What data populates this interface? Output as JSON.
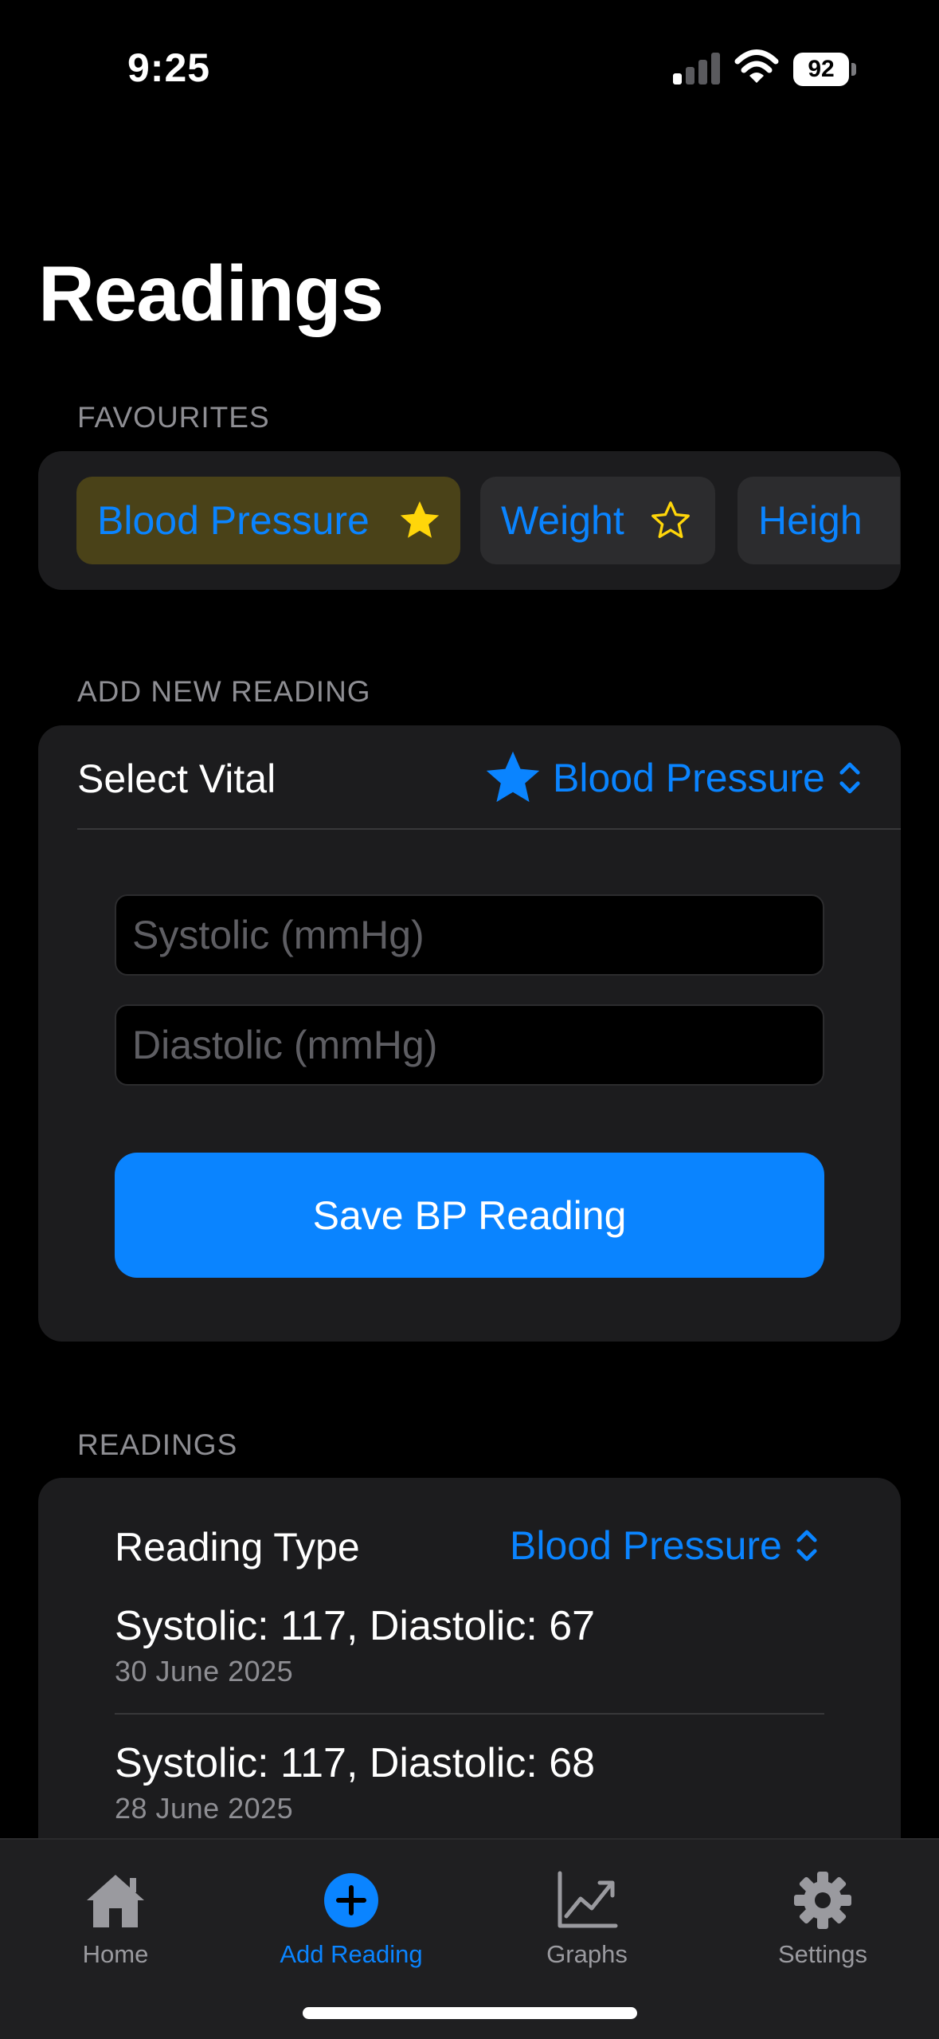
{
  "status_bar": {
    "time": "9:25",
    "battery": "92"
  },
  "page": {
    "title": "Readings"
  },
  "favourites": {
    "header": "FAVOURITES",
    "chips": [
      {
        "label": "Blood Pressure",
        "favourite": true
      },
      {
        "label": "Weight",
        "favourite": false
      },
      {
        "label": "Heigh",
        "favourite": false
      }
    ]
  },
  "add_reading": {
    "header": "ADD NEW READING",
    "select_label": "Select Vital",
    "selected_vital": "Blood Pressure",
    "systolic_placeholder": "Systolic (mmHg)",
    "diastolic_placeholder": "Diastolic (mmHg)",
    "save_label": "Save BP Reading"
  },
  "readings": {
    "header": "READINGS",
    "type_label": "Reading Type",
    "type_value": "Blood Pressure",
    "items": [
      {
        "value": "Systolic: 117, Diastolic: 67",
        "date": "30 June 2025"
      },
      {
        "value": "Systolic: 117, Diastolic: 68",
        "date": "28 June 2025"
      }
    ]
  },
  "tabbar": {
    "tabs": [
      {
        "label": "Home",
        "icon": "house-icon"
      },
      {
        "label": "Add Reading",
        "icon": "plus-circle-icon",
        "active": true
      },
      {
        "label": "Graphs",
        "icon": "chart-line-icon"
      },
      {
        "label": "Settings",
        "icon": "gear-icon"
      }
    ]
  },
  "colors": {
    "accent": "#0a84ff",
    "star": "#ffd60a",
    "card": "#1c1c1e",
    "active_chip": "#4a4218"
  }
}
